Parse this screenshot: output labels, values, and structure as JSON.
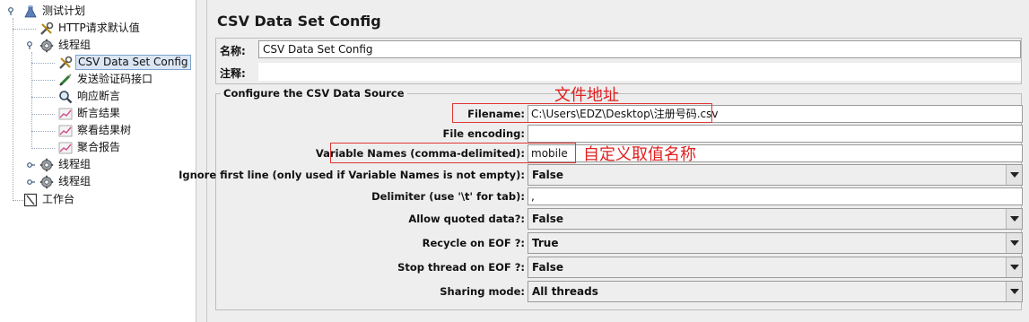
{
  "tree": {
    "items": [
      {
        "label": "测试计划",
        "icon": "test-plan-icon"
      },
      {
        "label": "HTTP请求默认值",
        "icon": "wrench-icon"
      },
      {
        "label": "线程组",
        "icon": "gear-icon"
      },
      {
        "label": "CSV Data Set Config",
        "icon": "wrench-icon"
      },
      {
        "label": "发送验证码接口",
        "icon": "sampler-pen-icon"
      },
      {
        "label": "响应断言",
        "icon": "magnifier-icon"
      },
      {
        "label": "断言结果",
        "icon": "graph-icon"
      },
      {
        "label": "察看结果树",
        "icon": "graph-icon"
      },
      {
        "label": "聚合报告",
        "icon": "graph-icon"
      },
      {
        "label": "线程组",
        "icon": "gear-icon"
      },
      {
        "label": "线程组",
        "icon": "gear-icon"
      },
      {
        "label": "工作台",
        "icon": "workbench-icon"
      }
    ]
  },
  "main": {
    "title": "CSV Data Set Config",
    "name_label": "名称:",
    "name_value": "CSV Data Set Config",
    "comment_label": "注释:",
    "comment_value": "",
    "group_title": "Configure the CSV Data Source",
    "fields": [
      {
        "label": "Filename:",
        "value": "C:\\Users\\EDZ\\Desktop\\注册号码.csv",
        "type": "text"
      },
      {
        "label": "File encoding:",
        "value": "",
        "type": "text"
      },
      {
        "label": "Variable Names (comma-delimited):",
        "value": "mobile",
        "type": "text"
      },
      {
        "label": "Ignore first line (only used if Variable Names is not empty):",
        "value": "False",
        "type": "select"
      },
      {
        "label": "Delimiter (use '\\t' for tab):",
        "value": ",",
        "type": "text"
      },
      {
        "label": "Allow quoted data?:",
        "value": "False",
        "type": "select"
      },
      {
        "label": "Recycle on EOF ?:",
        "value": "True",
        "type": "select"
      },
      {
        "label": "Stop thread on EOF ?:",
        "value": "False",
        "type": "select"
      },
      {
        "label": "Sharing mode:",
        "value": "All threads",
        "type": "select"
      }
    ]
  },
  "annotations": {
    "filename_note": "文件地址",
    "varnames_note": "自定义取值名称",
    "color": "#e02020"
  },
  "colors": {
    "selection_bg": "#dbe6f5",
    "selection_border": "#7da2ce",
    "panel_bg": "#eeeeee"
  }
}
